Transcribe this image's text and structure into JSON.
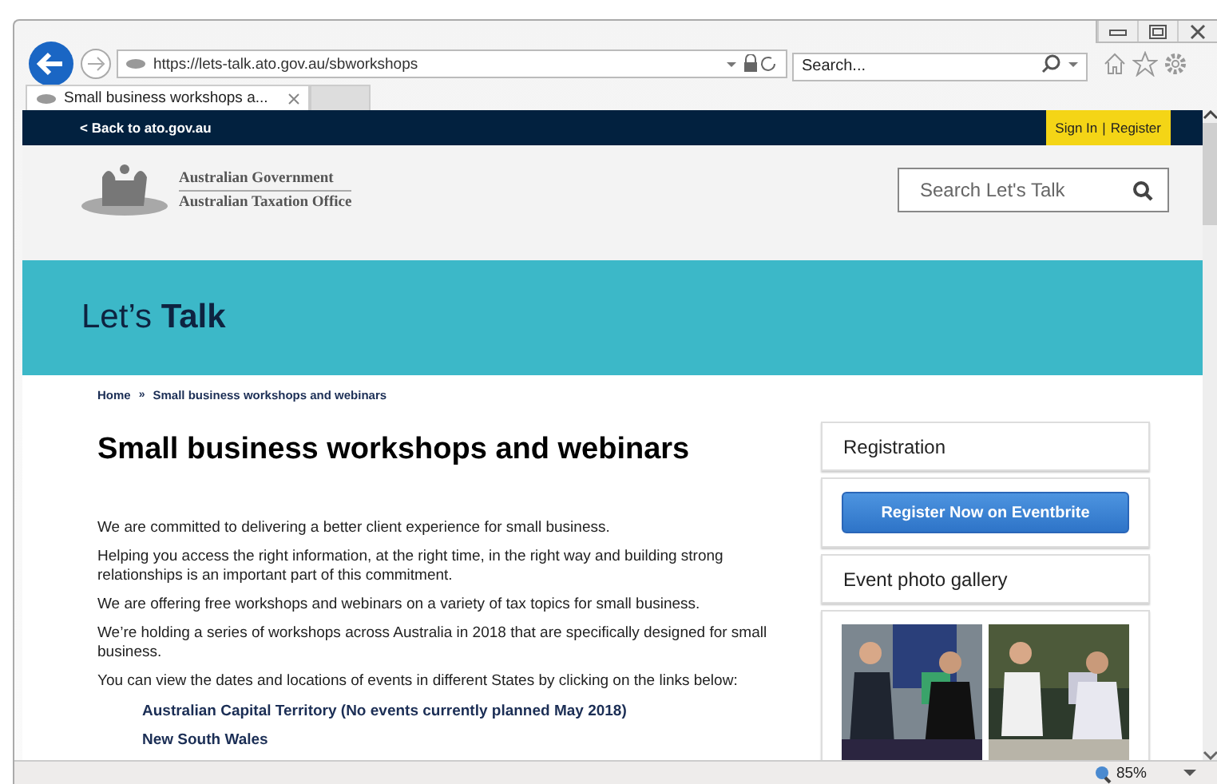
{
  "browser": {
    "url": "https://lets-talk.ato.gov.au/sbworkshops",
    "search_placeholder": "Search...",
    "tab_title": "Small business workshops a...",
    "zoom": "85%"
  },
  "top_bar": {
    "back_link": "< Back to ato.gov.au",
    "links": [
      "Sign In",
      "Register"
    ],
    "separator": "|"
  },
  "header": {
    "logo_lines": [
      "Australian Government",
      "Australian Taxation Office"
    ],
    "search_placeholder": "Search Let's Talk"
  },
  "banner": {
    "title": "Let’s **Talk**"
  },
  "breadcrumb": {
    "items": [
      "Home",
      "Small business workshops and webinars"
    ],
    "separator": "»"
  },
  "heading": "Small business workshops and webinars",
  "paragraphs": [
    "We are committed to delivering a better client experience for small business.",
    "Helping you access the right information, at the right time, in the right way and building strong relationships is an important part of this commitment.",
    "We are offering free workshops and webinars on a variety of tax topics for small business.",
    "We’re holding a series of workshops across Australia in 2018 that are specifically designed for small business.",
    "You can view the dates and locations of events in different States by clicking on the links below:"
  ],
  "state_links": [
    "Australian Capital Territory (No events currently planned May 2018)",
    "New South Wales"
  ],
  "sidebar": {
    "registration_title": "Registration",
    "register_button": "Register Now on Eventbrite",
    "gallery_title": "Event photo gallery"
  }
}
